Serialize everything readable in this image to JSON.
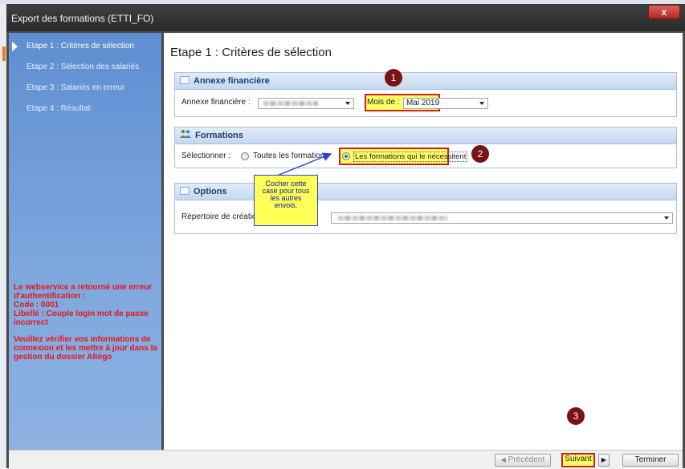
{
  "window": {
    "title": "Export des formations (ETTI_FO)",
    "close_label": "x"
  },
  "sidebar": {
    "steps": [
      {
        "label": "Etape 1 : Critères de sélection"
      },
      {
        "label": "Etape 2 : Sélection des salariés"
      },
      {
        "label": "Etape 3 : Salariés en erreur"
      },
      {
        "label": "Etape 4 : Résultat"
      }
    ],
    "error_message": [
      "Le webservice a retourné une erreur d'authentification :",
      "Code : 0001",
      "Libellé : Couple login mot de passe incorrect"
    ],
    "error_advice": "Veuillez vérifier vos informations de connexion et les mettre à jour dans la gestion du dossier Altégo"
  },
  "main": {
    "heading": "Etape 1 : Critères de sélection",
    "annexe": {
      "section_title": "Annexe financière",
      "label": "Annexe financière :",
      "month_label": "Mois de :",
      "month_value": "Mai 2019"
    },
    "formations": {
      "section_title": "Formations",
      "select_label": "Sélectionner :",
      "option_all": "Toutes les formations",
      "option_needed": "Les formations qui le nécessitent",
      "selected": "option_needed"
    },
    "options": {
      "section_title": "Options",
      "dir_label": "Répertoire de création"
    }
  },
  "annotations": {
    "markers": [
      "1",
      "2",
      "3"
    ],
    "callout_lines": [
      "Cocher cette",
      "case pour tous",
      "les autres",
      "envois."
    ]
  },
  "footer": {
    "prev_label": "Précédent",
    "next_label": "Suivant",
    "finish_label": "Terminer"
  },
  "colors": {
    "sidebar": "#6f9bd9",
    "error": "#e8141a",
    "highlight": "#ffff66",
    "highlight_border": "#d0201b",
    "marker": "#7a1414"
  }
}
